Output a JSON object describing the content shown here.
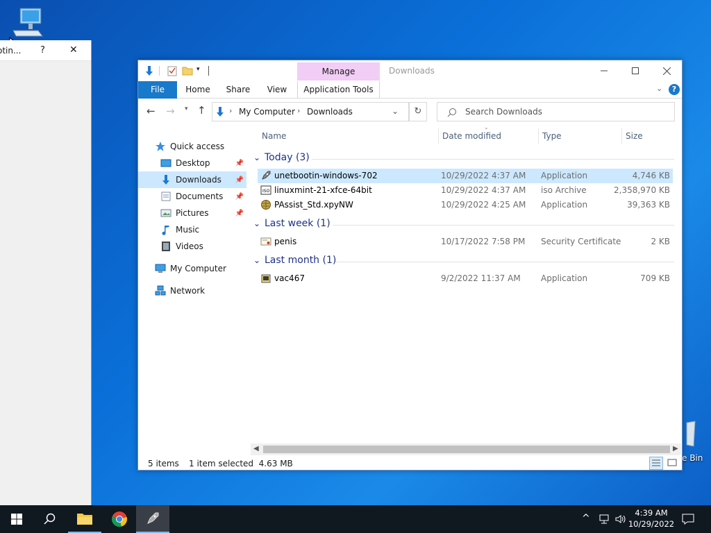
{
  "desktop": {
    "recycle_bin_label": "e Bin"
  },
  "left_window": {
    "title_partial": "otin...",
    "help": "?",
    "close": "✕"
  },
  "explorer": {
    "title": "Downloads",
    "context_tab": "Manage",
    "context_subtab": "Application Tools",
    "ribbon": {
      "file": "File",
      "home": "Home",
      "share": "Share",
      "view": "View"
    },
    "address": {
      "root": "My Computer",
      "folder": "Downloads"
    },
    "search_placeholder": "Search Downloads",
    "nav": {
      "quick_access": "Quick access",
      "desktop": "Desktop",
      "downloads": "Downloads",
      "documents": "Documents",
      "pictures": "Pictures",
      "music": "Music",
      "videos": "Videos",
      "my_computer": "My Computer",
      "network": "Network"
    },
    "columns": {
      "name": "Name",
      "date": "Date modified",
      "type": "Type",
      "size": "Size"
    },
    "groups": {
      "today": "Today (3)",
      "last_week": "Last week (1)",
      "last_month": "Last month (1)"
    },
    "files": [
      {
        "name": "unetbootin-windows-702",
        "date": "10/29/2022 4:37 AM",
        "type": "Application",
        "size": "4,746 KB"
      },
      {
        "name": "linuxmint-21-xfce-64bit",
        "date": "10/29/2022 4:37 AM",
        "type": "iso Archive",
        "size": "2,358,970 KB"
      },
      {
        "name": "PAssist_Std.xpyNW",
        "date": "10/29/2022 4:25 AM",
        "type": "Application",
        "size": "39,363 KB"
      },
      {
        "name": "penis",
        "date": "10/17/2022 7:58 PM",
        "type": "Security Certificate",
        "size": "2 KB"
      },
      {
        "name": "vac467",
        "date": "9/2/2022 11:37 AM",
        "type": "Application",
        "size": "709 KB"
      }
    ],
    "status": {
      "items": "5 items",
      "selected": "1 item selected  4.63 MB"
    }
  },
  "taskbar": {
    "time": "4:39 AM",
    "date": "10/29/2022"
  },
  "colors": {
    "accent": "#1979ca",
    "selection": "#cce8ff",
    "context_tab": "#f2cdf5",
    "taskbar": "#101820"
  }
}
